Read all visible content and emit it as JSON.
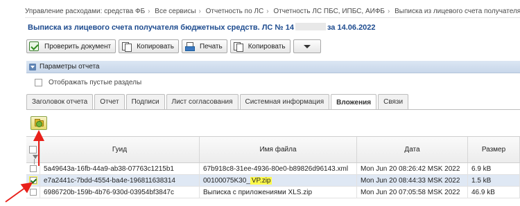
{
  "breadcrumb": [
    "Управление расходами: средства ФБ",
    "Все сервисы",
    "Отчетность по ЛС",
    "Отчетность ЛС ПБС, ИПБС, АИФБ",
    "Выписка из лицевого счета получателя бюджетных средств"
  ],
  "page_title": {
    "prefix": "Выписка из лицевого счета получателя бюджетных средств. ЛС № 14",
    "suffix": "за 14.06.2022"
  },
  "toolbar": {
    "verify_label": "Проверить документ",
    "copy1_label": "Копировать",
    "print_label": "Печать",
    "copy2_label": "Копировать"
  },
  "report_params": {
    "title": "Параметры отчета",
    "show_empty_label": "Отображать пустые разделы"
  },
  "tabs": [
    "Заголовок отчета",
    "Отчет",
    "Подписи",
    "Лист согласования",
    "Системная информация",
    "Вложения",
    "Связи"
  ],
  "active_tab": "Вложения",
  "table": {
    "headers": {
      "guid": "Гуид",
      "filename": "Имя файла",
      "date": "Дата",
      "size": "Размер"
    },
    "rows": [
      {
        "guid": "5a49643a-16fb-44a9-ab38-07763c1215b1",
        "filename": "67b918c8-31ee-4936-80e0-b89826d96143.xml",
        "date": "Mon Jun 20 08:26:42 MSK 2022",
        "size": "6.9 kB",
        "checked": false
      },
      {
        "guid": "e7a2441c-7bdd-4554-ba4e-196811638314",
        "filename_pre": "00100075K30_",
        "filename_hl": "VP.zip",
        "date": "Mon Jun 20 08:44:33 MSK 2022",
        "size": "1.5 kB",
        "checked": true
      },
      {
        "guid": "6986720b-159b-4b76-930d-03954bf3847c",
        "filename": "Выписка с приложениями XLS.zip",
        "date": "Mon Jun 20 07:05:58 MSK 2022",
        "size": "46.9 kB",
        "checked": false
      }
    ]
  },
  "colors": {
    "title": "#1c4a8e",
    "annotation_arrow": "#e8201a",
    "highlight": "#fffa4a"
  }
}
